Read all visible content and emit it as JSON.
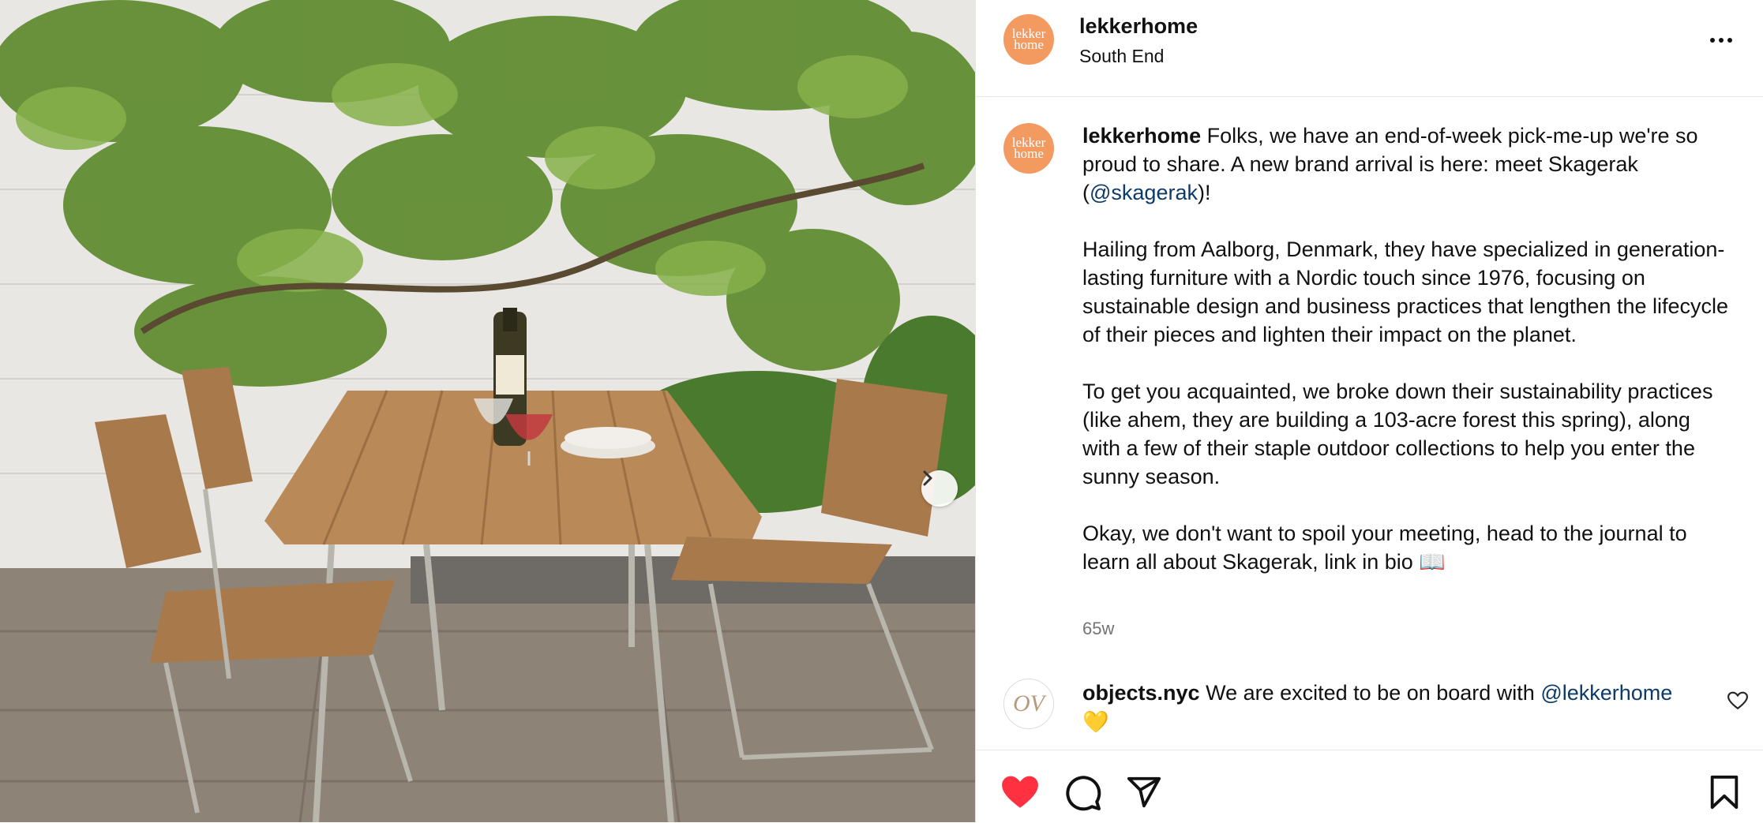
{
  "post": {
    "username": "lekkerhome",
    "location": "South End",
    "avatar_text": [
      "lekker",
      "home"
    ],
    "caption_paragraphs": [
      {
        "before": "Folks, we have an end-of-week pick-me-up we're so proud to share. A new brand arrival is here: meet Skagerak (",
        "mention": "@skagerak",
        "after": ")!"
      },
      "Hailing from Aalborg, Denmark, they have specialized in generation-lasting furniture with a Nordic touch since 1976, focusing on sustainable design and business practices that lengthen the lifecycle of their pieces and lighten their impact on the planet.",
      "To get you acquainted, we broke down their sustainability practices (like ahem, they are building a 103-acre forest this spring), along with a few of their staple outdoor collections to help you enter the sunny season.",
      "Okay, we don't want to spoil your meeting, head to the journal to learn all about Skagerak, link in bio 📖"
    ],
    "timestamp": "65w"
  },
  "comment": {
    "username": "objects.nyc",
    "text": "We are excited to be on board with",
    "mention": "@lekkerhome",
    "emoji": "💛",
    "avatar_text": "OV"
  },
  "icons": {
    "more": "more-options-icon",
    "like": "heart-filled-icon",
    "comment": "comment-icon",
    "share": "paper-plane-icon",
    "save": "bookmark-icon",
    "next": "chevron-right-icon"
  },
  "colors": {
    "like": "#ff3040",
    "avatar_bg": "#f39a61",
    "link": "#0b3a6b",
    "muted": "#737373"
  }
}
